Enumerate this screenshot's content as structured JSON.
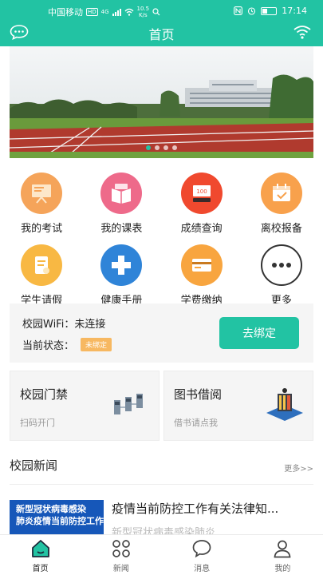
{
  "status_bar": {
    "carrier": "中国移动",
    "hd": "HD",
    "net": "4G",
    "speed_value": "10.5",
    "speed_unit": "K/s",
    "time": "17:14"
  },
  "header": {
    "title": "首页"
  },
  "banner": {
    "slides": 4,
    "active_slide": 1
  },
  "grid": {
    "row1": [
      {
        "label": "我的考试",
        "icon": "exam-presentation-icon",
        "color": "#f5a45a"
      },
      {
        "label": "我的课表",
        "icon": "schedule-book-icon",
        "color": "#ee6a8a"
      },
      {
        "label": "成绩查询",
        "icon": "score-query-icon",
        "color": "#f0492e"
      },
      {
        "label": "离校报备",
        "icon": "leave-calendar-icon",
        "color": "#f8a14c"
      }
    ],
    "row2": [
      {
        "label": "学生请假",
        "icon": "leave-request-icon",
        "color": "#f8b843"
      },
      {
        "label": "健康手册",
        "icon": "health-cross-icon",
        "color": "#2f84d8"
      },
      {
        "label": "学费缴纳",
        "icon": "tuition-card-icon",
        "color": "#f8a53f"
      },
      {
        "label": "更多",
        "icon": "more-dots-icon",
        "color": "#333333"
      }
    ]
  },
  "wifi": {
    "label": "校园WiFi：未连接",
    "state_label": "当前状态：",
    "state_badge": "未绑定",
    "bind_button": "去绑定"
  },
  "cards": {
    "gate": {
      "title": "校园门禁",
      "sub": "扫码开门",
      "icon": "turnstile-gate-icon"
    },
    "library": {
      "title": "图书借阅",
      "sub": "借书请点我",
      "icon": "library-books-icon"
    }
  },
  "news": {
    "section_title": "校园新闻",
    "more": "更多>>",
    "items": [
      {
        "title": "疫情当前防控工作有关法律知...",
        "summary": "新型冠状病毒感染肺炎",
        "thumb_lines": [
          "新型冠状病毒感染",
          "肺炎疫情当前防控工作"
        ]
      }
    ]
  },
  "tabbar": [
    {
      "label": "首页",
      "icon": "home-icon",
      "active": true
    },
    {
      "label": "新闻",
      "icon": "news-grid-icon",
      "active": false
    },
    {
      "label": "消息",
      "icon": "message-bubble-icon",
      "active": false
    },
    {
      "label": "我的",
      "icon": "profile-person-icon",
      "active": false
    }
  ],
  "colors": {
    "primary": "#22c3a3",
    "badge": "#f7b861",
    "news_thumb": "#1657b9"
  }
}
